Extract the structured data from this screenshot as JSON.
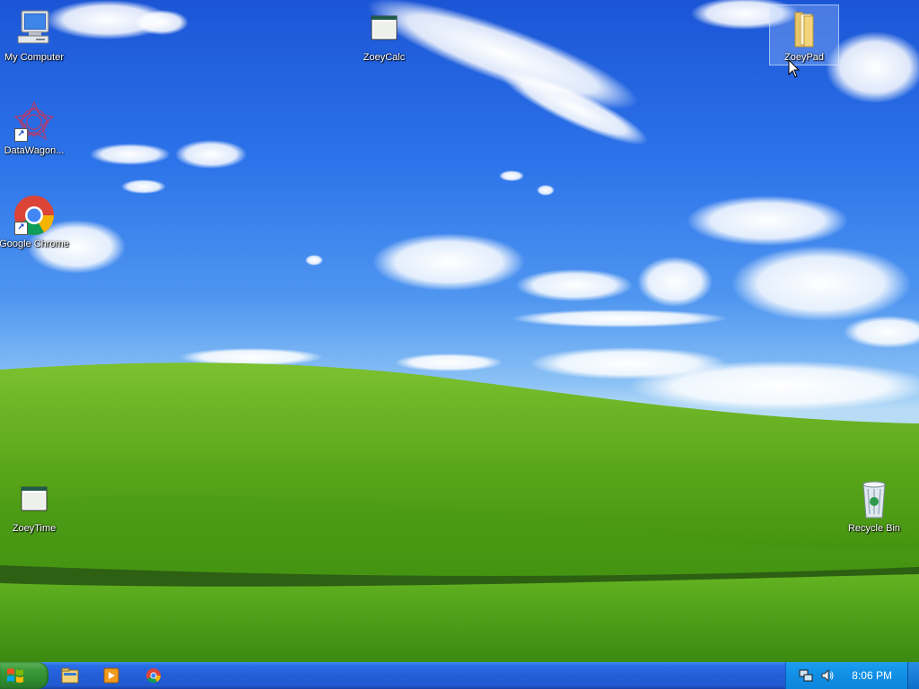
{
  "desktop": {
    "icons": [
      {
        "label": "My Computer",
        "icon": "computer-icon"
      },
      {
        "label": "ZoeyCalc",
        "icon": "app-window-icon"
      },
      {
        "label": "ZoeyPad",
        "icon": "folder-icon",
        "selected": true
      },
      {
        "label": "DataWagon...",
        "icon": "datawagon-icon",
        "shortcut": true
      },
      {
        "label": "Google Chrome",
        "icon": "chrome-icon",
        "shortcut": true
      },
      {
        "label": "ZoeyTime",
        "icon": "app-window-icon"
      },
      {
        "label": "Recycle Bin",
        "icon": "recycle-bin-icon"
      }
    ]
  },
  "taskbar": {
    "start_icon": "windows-logo-icon",
    "quick_launch": [
      "file-explorer-icon",
      "media-player-icon",
      "chrome-icon"
    ],
    "tray_icons": [
      "network-icon",
      "volume-icon"
    ],
    "clock": "8:06 PM"
  },
  "colors": {
    "sky": "#2d74ea",
    "grass": "#5aa61a",
    "taskbar": "#245dd6",
    "start_button": "#3c9a3b",
    "tray": "#1190e6"
  }
}
